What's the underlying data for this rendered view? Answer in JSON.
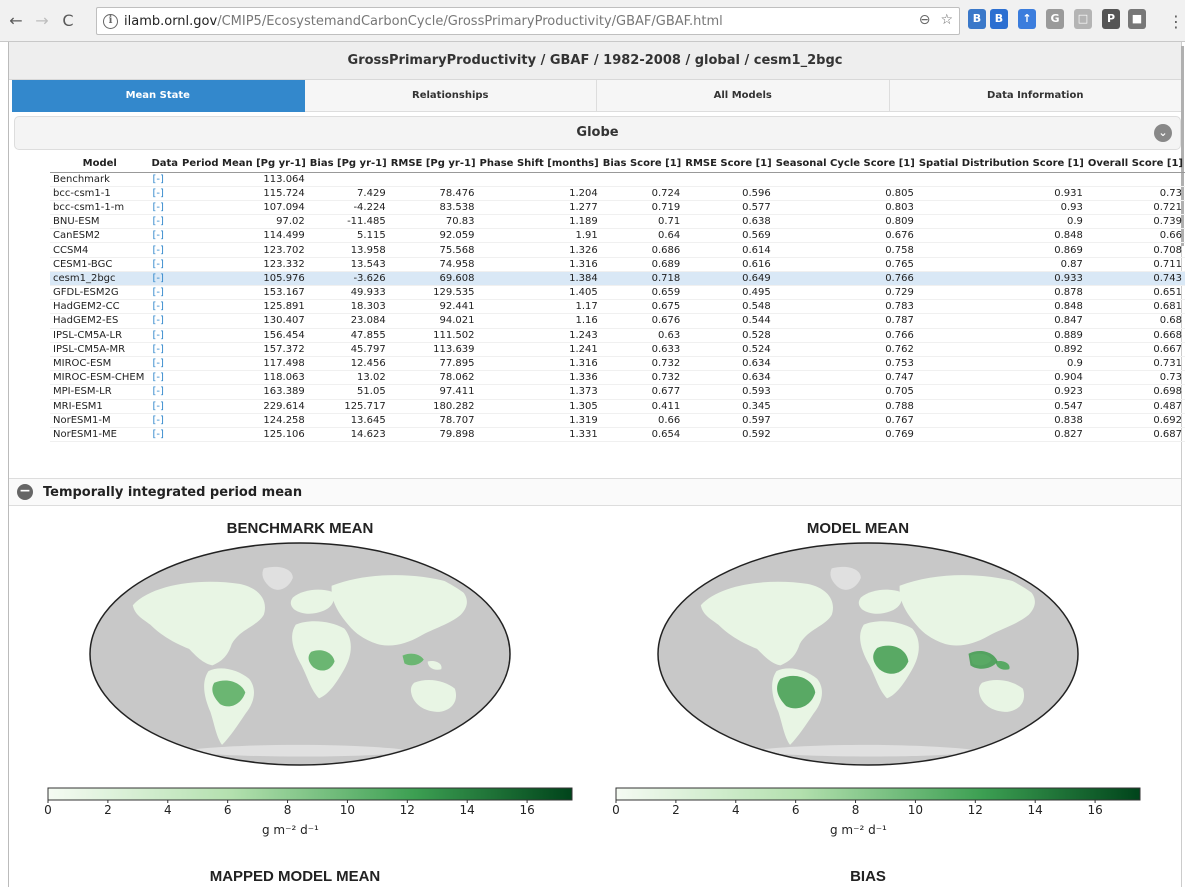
{
  "browser": {
    "url_host": "ilamb.ornl.gov",
    "url_path": "/CMIP5/EcosystemandCarbonCycle/GrossPrimaryProductivity/GBAF/GBAF.html",
    "back_icon": "←",
    "forward_icon": "→",
    "reload_icon": "C",
    "info_icon": "i",
    "zoom_icon": "⊖",
    "star_icon": "☆",
    "menu_icon": "⋮",
    "extensions": [
      {
        "name": "B",
        "color": "#3a78c9"
      },
      {
        "name": "B",
        "color": "#2c6fd1"
      },
      {
        "name": "↑",
        "color": "#3b7ddd"
      },
      {
        "name": "G",
        "color": "#9a9a9a"
      },
      {
        "name": "□",
        "color": "#b4b4b4"
      },
      {
        "name": "P",
        "color": "#555555"
      },
      {
        "name": "■",
        "color": "#777777"
      }
    ]
  },
  "header": {
    "title": "GrossPrimaryProductivity / GBAF / 1982-2008 / global / cesm1_2bgc"
  },
  "tabs": [
    {
      "label": "Mean State",
      "active": true
    },
    {
      "label": "Relationships",
      "active": false
    },
    {
      "label": "All Models",
      "active": false
    },
    {
      "label": "Data Information",
      "active": false
    }
  ],
  "region": {
    "label": "Globe"
  },
  "table": {
    "columns": [
      "Model",
      "Data",
      "Period Mean [Pg yr-1]",
      "Bias [Pg yr-1]",
      "RMSE [Pg yr-1]",
      "Phase Shift [months]",
      "Bias Score [1]",
      "RMSE Score [1]",
      "Seasonal Cycle Score [1]",
      "Spatial Distribution Score [1]",
      "Overall Score [1]"
    ],
    "data_link": "[-]",
    "rows": [
      {
        "model": "Benchmark",
        "period_mean": "113.064",
        "bias": "",
        "rmse": "",
        "phase": "",
        "bias_score": "",
        "rmse_score": "",
        "seasonal": "",
        "spatial": "",
        "overall": ""
      },
      {
        "model": "bcc-csm1-1",
        "period_mean": "115.724",
        "bias": "7.429",
        "rmse": "78.476",
        "phase": "1.204",
        "bias_score": "0.724",
        "rmse_score": "0.596",
        "seasonal": "0.805",
        "spatial": "0.931",
        "overall": "0.73"
      },
      {
        "model": "bcc-csm1-1-m",
        "period_mean": "107.094",
        "bias": "-4.224",
        "rmse": "83.538",
        "phase": "1.277",
        "bias_score": "0.719",
        "rmse_score": "0.577",
        "seasonal": "0.803",
        "spatial": "0.93",
        "overall": "0.721"
      },
      {
        "model": "BNU-ESM",
        "period_mean": "97.02",
        "bias": "-11.485",
        "rmse": "70.83",
        "phase": "1.189",
        "bias_score": "0.71",
        "rmse_score": "0.638",
        "seasonal": "0.809",
        "spatial": "0.9",
        "overall": "0.739"
      },
      {
        "model": "CanESM2",
        "period_mean": "114.499",
        "bias": "5.115",
        "rmse": "92.059",
        "phase": "1.91",
        "bias_score": "0.64",
        "rmse_score": "0.569",
        "seasonal": "0.676",
        "spatial": "0.848",
        "overall": "0.66"
      },
      {
        "model": "CCSM4",
        "period_mean": "123.702",
        "bias": "13.958",
        "rmse": "75.568",
        "phase": "1.326",
        "bias_score": "0.686",
        "rmse_score": "0.614",
        "seasonal": "0.758",
        "spatial": "0.869",
        "overall": "0.708"
      },
      {
        "model": "CESM1-BGC",
        "period_mean": "123.332",
        "bias": "13.543",
        "rmse": "74.958",
        "phase": "1.316",
        "bias_score": "0.689",
        "rmse_score": "0.616",
        "seasonal": "0.765",
        "spatial": "0.87",
        "overall": "0.711"
      },
      {
        "model": "cesm1_2bgc",
        "period_mean": "105.976",
        "bias": "-3.626",
        "rmse": "69.608",
        "phase": "1.384",
        "bias_score": "0.718",
        "rmse_score": "0.649",
        "seasonal": "0.766",
        "spatial": "0.933",
        "overall": "0.743",
        "highlight": true
      },
      {
        "model": "GFDL-ESM2G",
        "period_mean": "153.167",
        "bias": "49.933",
        "rmse": "129.535",
        "phase": "1.405",
        "bias_score": "0.659",
        "rmse_score": "0.495",
        "seasonal": "0.729",
        "spatial": "0.878",
        "overall": "0.651"
      },
      {
        "model": "HadGEM2-CC",
        "period_mean": "125.891",
        "bias": "18.303",
        "rmse": "92.441",
        "phase": "1.17",
        "bias_score": "0.675",
        "rmse_score": "0.548",
        "seasonal": "0.783",
        "spatial": "0.848",
        "overall": "0.681"
      },
      {
        "model": "HadGEM2-ES",
        "period_mean": "130.407",
        "bias": "23.084",
        "rmse": "94.021",
        "phase": "1.16",
        "bias_score": "0.676",
        "rmse_score": "0.544",
        "seasonal": "0.787",
        "spatial": "0.847",
        "overall": "0.68"
      },
      {
        "model": "IPSL-CM5A-LR",
        "period_mean": "156.454",
        "bias": "47.855",
        "rmse": "111.502",
        "phase": "1.243",
        "bias_score": "0.63",
        "rmse_score": "0.528",
        "seasonal": "0.766",
        "spatial": "0.889",
        "overall": "0.668"
      },
      {
        "model": "IPSL-CM5A-MR",
        "period_mean": "157.372",
        "bias": "45.797",
        "rmse": "113.639",
        "phase": "1.241",
        "bias_score": "0.633",
        "rmse_score": "0.524",
        "seasonal": "0.762",
        "spatial": "0.892",
        "overall": "0.667"
      },
      {
        "model": "MIROC-ESM",
        "period_mean": "117.498",
        "bias": "12.456",
        "rmse": "77.895",
        "phase": "1.316",
        "bias_score": "0.732",
        "rmse_score": "0.634",
        "seasonal": "0.753",
        "spatial": "0.9",
        "overall": "0.731"
      },
      {
        "model": "MIROC-ESM-CHEM",
        "period_mean": "118.063",
        "bias": "13.02",
        "rmse": "78.062",
        "phase": "1.336",
        "bias_score": "0.732",
        "rmse_score": "0.634",
        "seasonal": "0.747",
        "spatial": "0.904",
        "overall": "0.73"
      },
      {
        "model": "MPI-ESM-LR",
        "period_mean": "163.389",
        "bias": "51.05",
        "rmse": "97.411",
        "phase": "1.373",
        "bias_score": "0.677",
        "rmse_score": "0.593",
        "seasonal": "0.705",
        "spatial": "0.923",
        "overall": "0.698"
      },
      {
        "model": "MRI-ESM1",
        "period_mean": "229.614",
        "bias": "125.717",
        "rmse": "180.282",
        "phase": "1.305",
        "bias_score": "0.411",
        "rmse_score": "0.345",
        "seasonal": "0.788",
        "spatial": "0.547",
        "overall": "0.487"
      },
      {
        "model": "NorESM1-M",
        "period_mean": "124.258",
        "bias": "13.645",
        "rmse": "78.707",
        "phase": "1.319",
        "bias_score": "0.66",
        "rmse_score": "0.597",
        "seasonal": "0.767",
        "spatial": "0.838",
        "overall": "0.692"
      },
      {
        "model": "NorESM1-ME",
        "period_mean": "125.106",
        "bias": "14.623",
        "rmse": "79.898",
        "phase": "1.331",
        "bias_score": "0.654",
        "rmse_score": "0.592",
        "seasonal": "0.769",
        "spatial": "0.827",
        "overall": "0.687"
      }
    ]
  },
  "section": {
    "label": "Temporally integrated period mean",
    "toggle_icon": "−"
  },
  "maps": {
    "benchmark_title": "BENCHMARK MEAN",
    "model_title": "MODEL MEAN",
    "mapped_title": "MAPPED MODEL MEAN",
    "bias_title": "BIAS",
    "colorbar_ticks": [
      "0",
      "2",
      "4",
      "6",
      "8",
      "10",
      "12",
      "14",
      "16"
    ],
    "colorbar_max": 17.5,
    "unit_label": "g m⁻² d⁻¹",
    "colors": {
      "ocean": "#c8c8c8",
      "land_low": "#e8f5e4",
      "land_high": "#0a5a2a",
      "ice": "#e0e0e0"
    }
  }
}
